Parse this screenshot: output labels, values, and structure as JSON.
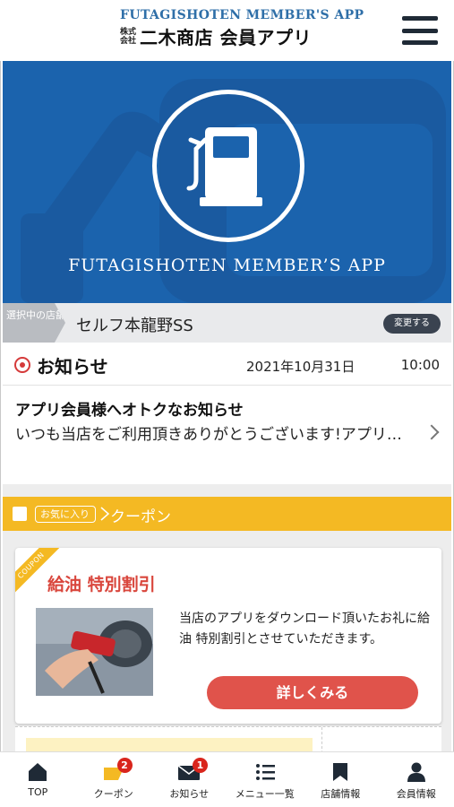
{
  "header": {
    "app_name_en": "FUTAGISHOTEN MEMBER'S APP",
    "company_type": "株式会社",
    "app_name_jp": "二木商店 会員アプリ",
    "menu_icon": "hamburger-menu-icon"
  },
  "hero": {
    "icon": "fuel-pump-icon",
    "title": "FUTAGISHOTEN MEMBER’S APP"
  },
  "store": {
    "tag_label": "選択中の店舗",
    "name": "セルフ本龍野SS",
    "change_label": "変更する"
  },
  "news": {
    "section_title": "お知らせ",
    "date": "2021年10月31日",
    "time": "10:00",
    "item_title": "アプリ会員様へオトクなお知らせ",
    "item_body": "いつも当店をご利用頂きありがとうございます!アプリ…"
  },
  "coupon_section": {
    "favorite_label": "お気に入り",
    "label": "クーポン"
  },
  "coupon": {
    "ribbon": "COUPON",
    "title": "給油 特別割引",
    "description": "当店のアプリをダウンロード頂いたお礼に給油 特別割引とさせていただきます。",
    "detail_button": "詳しくみる"
  },
  "nav": {
    "items": [
      {
        "label": "TOP",
        "icon": "home-icon"
      },
      {
        "label": "クーポン",
        "icon": "coupon-icon",
        "badge": "2"
      },
      {
        "label": "お知らせ",
        "icon": "mail-icon",
        "badge": "1"
      },
      {
        "label": "メニュー一覧",
        "icon": "menu-list-icon"
      },
      {
        "label": "店舗情報",
        "icon": "store-icon"
      },
      {
        "label": "会員情報",
        "icon": "member-icon"
      }
    ]
  },
  "colors": {
    "brand_blue": "#1b63ad",
    "accent_yellow": "#f4b923",
    "accent_red": "#e0534b",
    "badge_red": "#d9251c"
  }
}
